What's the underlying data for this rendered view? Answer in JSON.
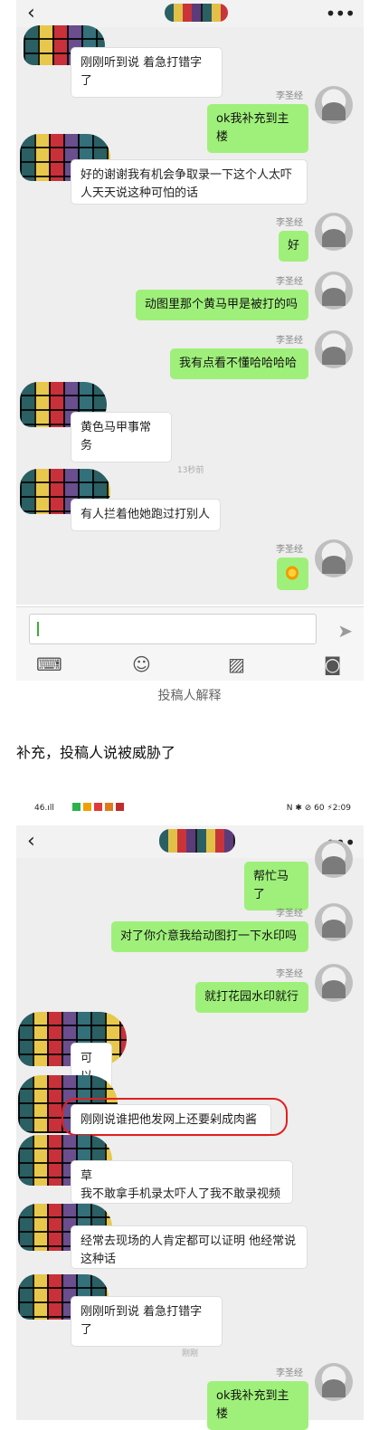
{
  "screen1": {
    "back_icon": "chevron-left",
    "more_icon": "ellipsis",
    "messages": [
      {
        "side": "left",
        "text": "刚刚听到说 着急打错字了"
      },
      {
        "side": "right",
        "sender": "李圣经",
        "text": "ok我补充到主楼"
      },
      {
        "side": "left",
        "text": "好的谢谢我有机会争取录一下这个人太吓\n人天天说这种可怕的话"
      },
      {
        "side": "right",
        "sender": "李圣经",
        "text": "好"
      },
      {
        "side": "right",
        "sender": "李圣经",
        "text": "动图里那个黄马甲是被打的吗"
      },
      {
        "side": "right",
        "sender": "李圣经",
        "text": "我有点看不懂哈哈哈哈"
      },
      {
        "side": "left",
        "text": "黄色马甲事常务"
      },
      {
        "side": "left",
        "text": "有人拦着他她跑过打别人"
      },
      {
        "side": "right",
        "sender": "李圣经",
        "sticker": "fire-sticker"
      }
    ],
    "time_divider": "13秒前",
    "icons": {
      "send": "send-icon",
      "keyboard": "keyboard-icon",
      "emoji": "emoji-icon",
      "image": "image-icon",
      "camera": "camera-icon"
    }
  },
  "caption": "投稿人解释",
  "note": "补充，投稿人说被威胁了",
  "screen2": {
    "status_left": "46.ıll",
    "status_right": "N ✱ ⊘ 60 ⚡2:09",
    "messages": [
      {
        "side": "right",
        "text": "帮忙马了"
      },
      {
        "side": "right",
        "sender": "李圣经",
        "text": "对了你介意我给动图打一下水印吗"
      },
      {
        "side": "right",
        "sender": "李圣经",
        "text": "就打花园水印就行"
      },
      {
        "side": "left",
        "text": "可以"
      },
      {
        "side": "left",
        "text": "刚刚说谁把他发网上还要剁成肉酱"
      },
      {
        "side": "left",
        "text": "草\n我不敢拿手机录太吓人了我不敢录视频"
      },
      {
        "side": "left",
        "text": "经常去现场的人肯定都可以证明 他经常说\n这种话"
      },
      {
        "side": "left",
        "text": "刚刚听到说 着急打错字了"
      },
      {
        "side": "right",
        "sender": "李圣经",
        "text": "ok我补充到主楼"
      }
    ],
    "time_divider": "刚刚"
  },
  "colors": {
    "right_bubble": "#9ff07a",
    "left_bubble": "#ffffff",
    "chat_bg": "#eeeeee",
    "highlight": "#e02020"
  }
}
